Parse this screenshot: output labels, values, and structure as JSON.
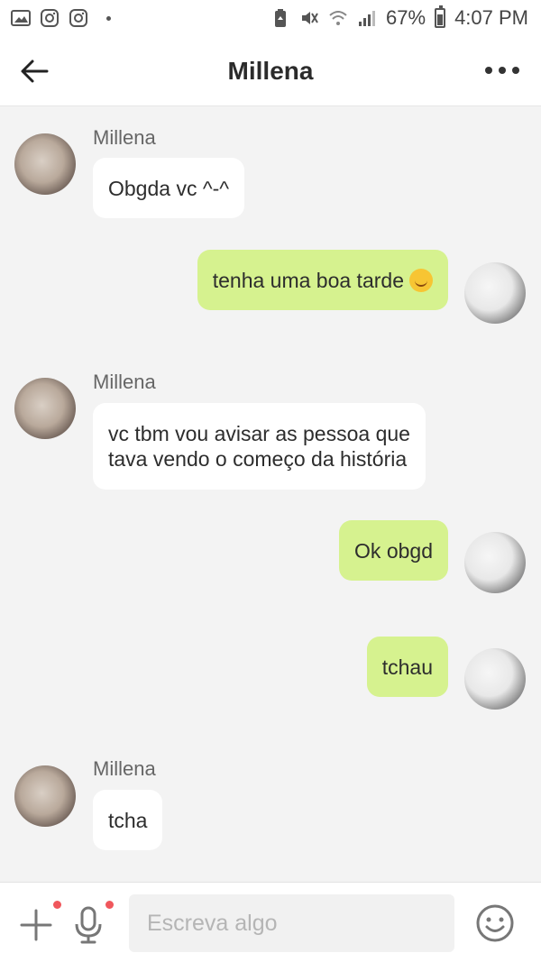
{
  "status_bar": {
    "battery": "67%",
    "time": "4:07 PM",
    "icons": [
      "gallery-icon",
      "instagram-icon",
      "instagram-icon",
      "battery-saver-icon",
      "mute-icon",
      "wifi-icon",
      "signal-icon",
      "battery-icon"
    ]
  },
  "header": {
    "title": "Millena",
    "back_icon": "arrow-left-icon",
    "menu_icon": "more-dots-icon"
  },
  "messages": [
    {
      "side": "them",
      "sender": "Millena",
      "text": "Obgda vc ^-^"
    },
    {
      "side": "me",
      "text": "tenha uma boa tarde",
      "emoji": "smiling-face-emoji"
    },
    {
      "side": "them",
      "sender": "Millena",
      "lines": [
        "vc tbm vou avisar as pessoa que",
        "tava vendo o começo da história"
      ]
    },
    {
      "side": "me",
      "text": "Ok obgd"
    },
    {
      "side": "me",
      "text": "tchau"
    },
    {
      "side": "them",
      "sender": "Millena",
      "text": "tcha"
    }
  ],
  "input_bar": {
    "placeholder": "Escreva algo",
    "value": "",
    "icons": [
      "plus-icon",
      "microphone-icon",
      "emoji-icon"
    ]
  },
  "colors": {
    "sent_bubble": "#d6f28f",
    "received_bubble": "#ffffff",
    "chat_background": "#f3f3f3",
    "notification_dot": "#f0575c"
  }
}
